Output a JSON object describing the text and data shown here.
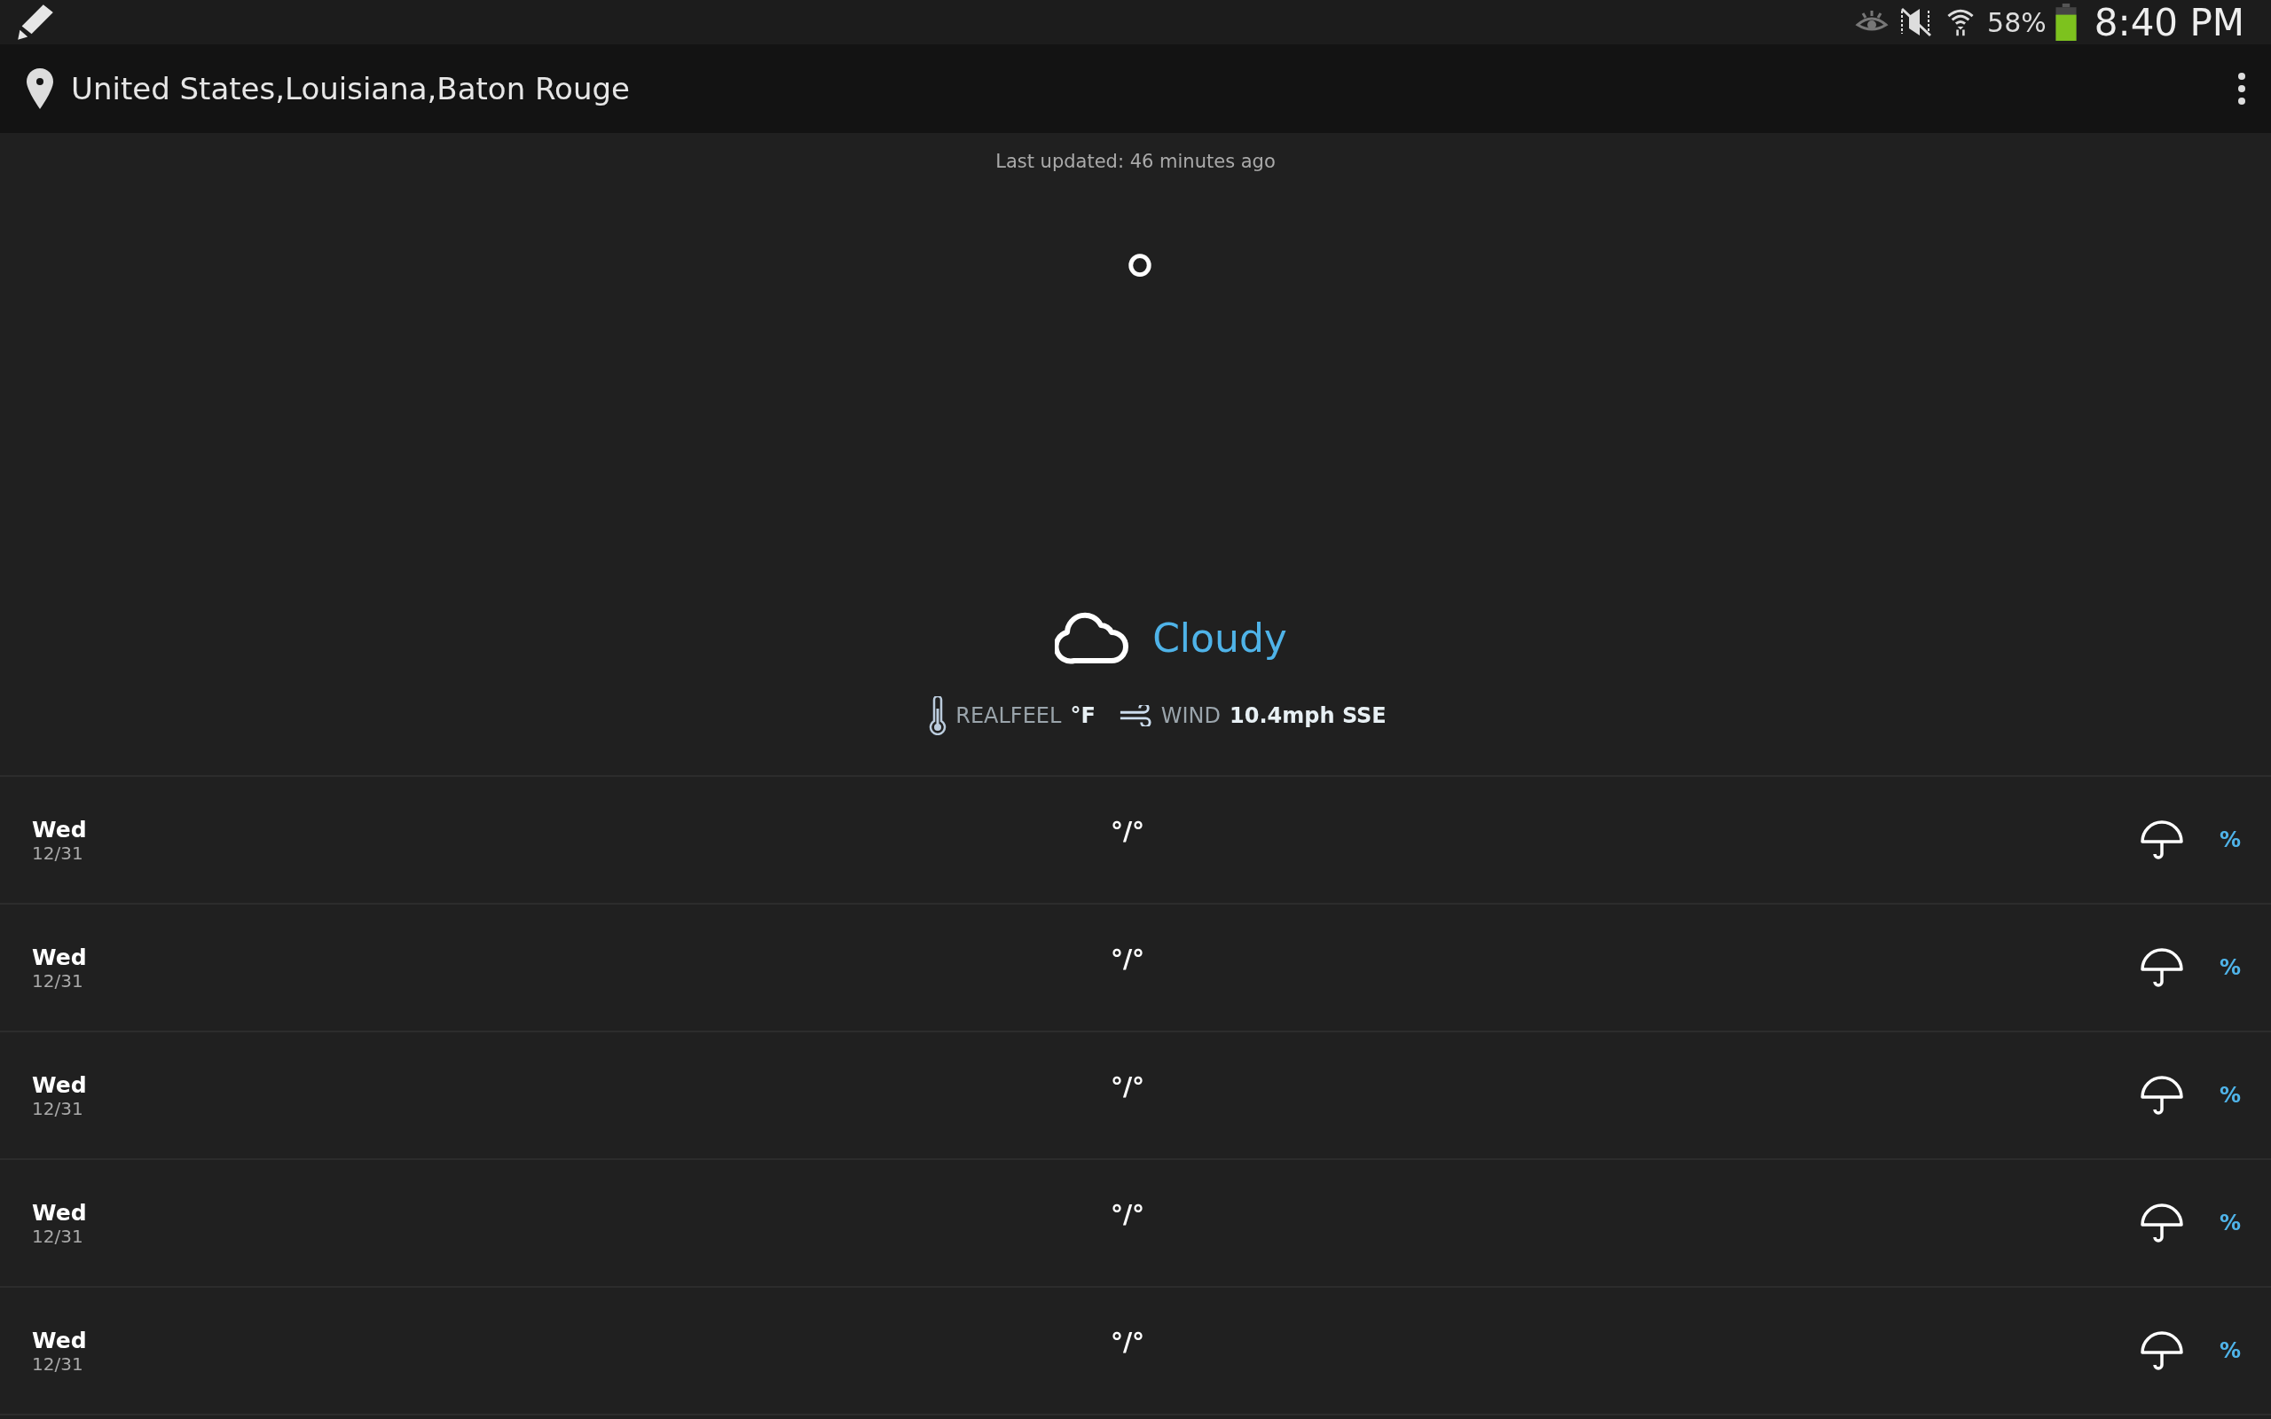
{
  "status_bar": {
    "battery": "58%",
    "time": "8:40 PM"
  },
  "header": {
    "location": "United States,Louisiana,Baton Rouge"
  },
  "last_updated": "Last updated: 46 minutes ago",
  "current": {
    "temperature": "°",
    "condition": "Cloudy",
    "realfeel_label": "REALFEEL",
    "realfeel_value": "°F",
    "wind_label": "WIND",
    "wind_value": "10.4mph SSE"
  },
  "forecast": [
    {
      "day": "Wed",
      "date": "12/31",
      "temps": "°/°",
      "precip": "%"
    },
    {
      "day": "Wed",
      "date": "12/31",
      "temps": "°/°",
      "precip": "%"
    },
    {
      "day": "Wed",
      "date": "12/31",
      "temps": "°/°",
      "precip": "%"
    },
    {
      "day": "Wed",
      "date": "12/31",
      "temps": "°/°",
      "precip": "%"
    },
    {
      "day": "Wed",
      "date": "12/31",
      "temps": "°/°",
      "precip": "%"
    }
  ]
}
